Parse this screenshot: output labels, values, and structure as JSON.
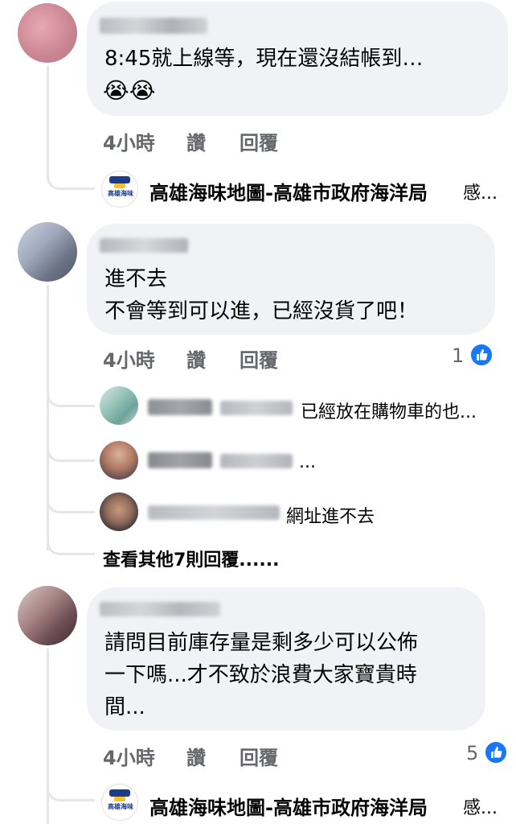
{
  "comments": [
    {
      "text_lines": [
        "8:45就上線等，現在還沒結帳到…"
      ],
      "emoji": "😭😭",
      "meta": {
        "time": "4小時",
        "like": "讚",
        "reply": "回覆"
      },
      "reply_preview": {
        "name": "高雄海味地圖-高雄市政府海洋局",
        "snippet": "感..."
      }
    },
    {
      "text_lines": [
        "進不去",
        "不會等到可以進，已經沒貨了吧！"
      ],
      "meta": {
        "time": "4小時",
        "like": "讚",
        "reply": "回覆"
      },
      "reactions": "1",
      "replies": [
        {
          "snippet": "已經放在購物車的也..."
        },
        {
          "snippet": "..."
        },
        {
          "snippet": "網址進不去"
        }
      ],
      "more_replies": "查看其他7則回覆......"
    },
    {
      "text_lines": [
        "請問目前庫存量是剩多少可以公佈",
        "一下嗎...才不致於浪費大家寶貴時",
        "間..."
      ],
      "meta": {
        "time": "4小時",
        "like": "讚",
        "reply": "回覆"
      },
      "reactions": "5",
      "reply_preview": {
        "name": "高雄海味地圖-高雄市政府海洋局",
        "snippet": "感..."
      }
    }
  ],
  "logo": {
    "text": "高雄海味",
    "subtext": "Kaohsiung Seafood"
  },
  "colors": {
    "bubble": "#f0f2f5",
    "meta": "#65676b",
    "like_blue": "#1877f2",
    "thread_line": "#e4e6eb"
  }
}
